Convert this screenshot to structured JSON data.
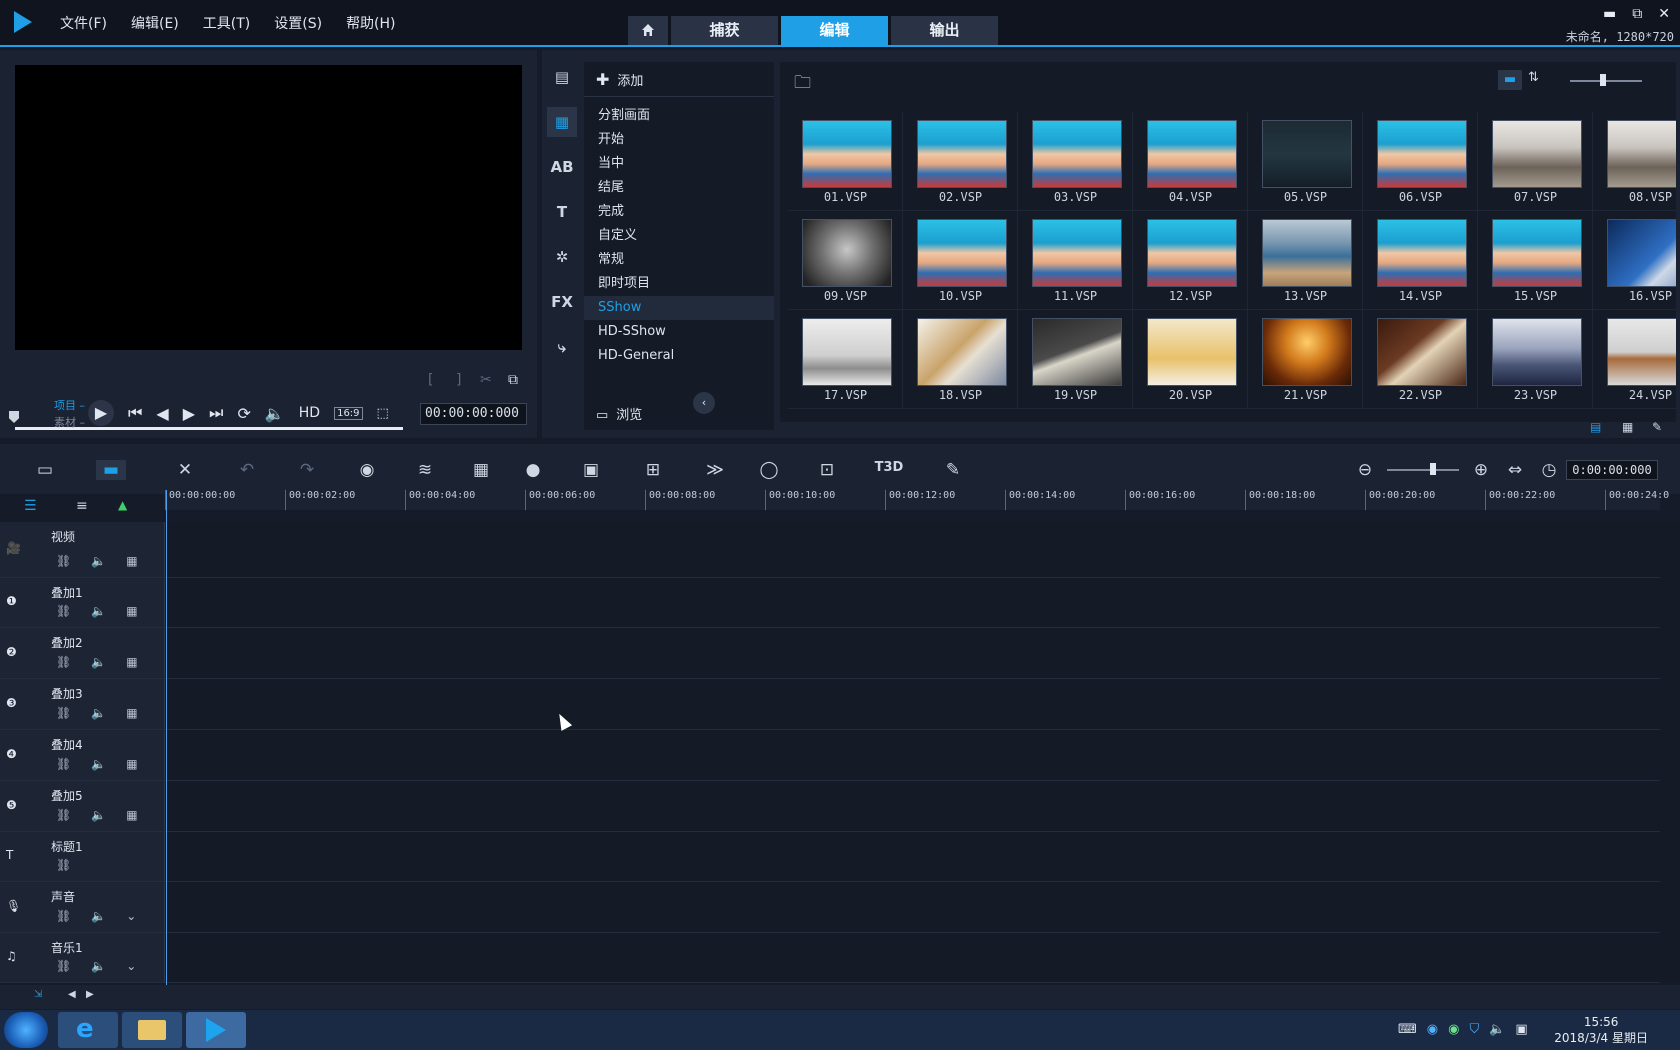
{
  "menu": [
    "文件(F)",
    "编辑(E)",
    "工具(T)",
    "设置(S)",
    "帮助(H)"
  ],
  "modes": {
    "capture": "捕获",
    "edit": "编辑",
    "output": "输出"
  },
  "window": {
    "project": "未命名, 1280*720",
    "minimize": "▬",
    "restore": "⧉",
    "close": "✕"
  },
  "preview": {
    "mode_project": "项目",
    "mode_clip": "素材",
    "hd": "HD",
    "ratio": "16:9",
    "timecode": "00:00:00:000"
  },
  "library": {
    "add_label": "添加",
    "browse_label": "浏览",
    "categories": [
      "分割画面",
      "开始",
      "当中",
      "结尾",
      "完成",
      "自定义",
      "常规",
      "即时项目",
      "SShow",
      "HD-SShow",
      "HD-General"
    ],
    "thumbs": [
      {
        "name": "01.VSP",
        "style": "pool"
      },
      {
        "name": "02.VSP",
        "style": "pool"
      },
      {
        "name": "03.VSP",
        "style": "pool"
      },
      {
        "name": "04.VSP",
        "style": "pool"
      },
      {
        "name": "05.VSP",
        "style": "dark"
      },
      {
        "name": "06.VSP",
        "style": "pool"
      },
      {
        "name": "07.VSP",
        "style": "street"
      },
      {
        "name": "08.VSP",
        "style": "street"
      },
      {
        "name": "09.VSP",
        "style": "bw"
      },
      {
        "name": "10.VSP",
        "style": "pool"
      },
      {
        "name": "11.VSP",
        "style": "pool"
      },
      {
        "name": "12.VSP",
        "style": "pool"
      },
      {
        "name": "13.VSP",
        "style": "beach"
      },
      {
        "name": "14.VSP",
        "style": "pool"
      },
      {
        "name": "15.VSP",
        "style": "pool"
      },
      {
        "name": "16.VSP",
        "style": "photos"
      },
      {
        "name": "17.VSP",
        "style": "monitor"
      },
      {
        "name": "18.VSP",
        "style": "bear"
      },
      {
        "name": "19.VSP",
        "style": "mytitle"
      },
      {
        "name": "20.VSP",
        "style": "baby"
      },
      {
        "name": "21.VSP",
        "style": "fire"
      },
      {
        "name": "22.VSP",
        "style": "travel"
      },
      {
        "name": "23.VSP",
        "style": "snow"
      },
      {
        "name": "24.VSP",
        "style": "crab"
      }
    ]
  },
  "timeline": {
    "timecode": "0:00:00:000",
    "ruler": [
      "00:00:00:00",
      "00:00:02:00",
      "00:00:04:00",
      "00:00:06:00",
      "00:00:08:00",
      "00:00:10:00",
      "00:00:12:00",
      "00:00:14:00",
      "00:00:16:00",
      "00:00:18:00",
      "00:00:20:00",
      "00:00:22:00",
      "00:00:24:0"
    ],
    "tracks": [
      "视频",
      "叠加1",
      "叠加2",
      "叠加3",
      "叠加4",
      "叠加5",
      "标题1",
      "声音",
      "音乐1"
    ]
  },
  "taskbar": {
    "time": "15:56",
    "date": "2018/3/4 星期日"
  },
  "colors": {
    "accent": "#1e9fe6",
    "background": "#151b28",
    "panel": "#1b2232"
  }
}
